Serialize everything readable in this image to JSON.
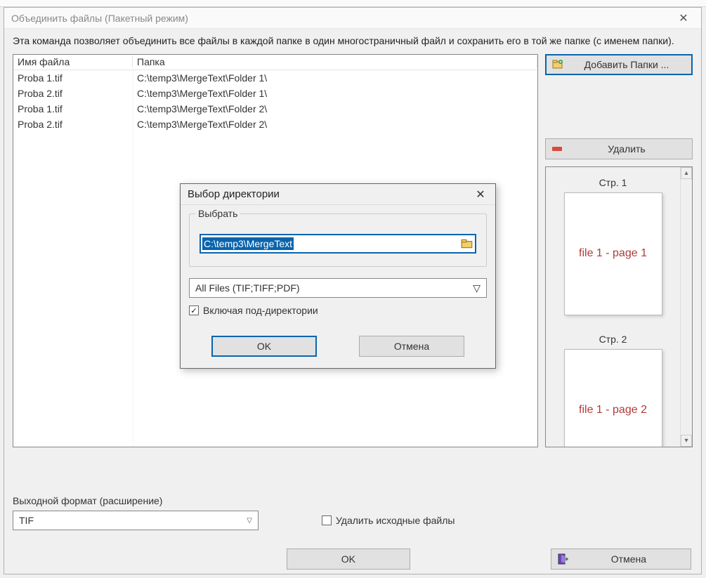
{
  "window": {
    "title": "Объединить файлы (Пакетный режим)",
    "description": "Эта команда позволяет объединить все файлы в каждой папке в один многостраничный файл и сохранить его в той же папке (с именем папки)."
  },
  "table": {
    "columns": {
      "name": "Имя файла",
      "folder": "Папка"
    },
    "rows": [
      {
        "name": "Proba 1.tif",
        "folder": "C:\\temp3\\MergeText\\Folder 1\\"
      },
      {
        "name": "Proba 2.tif",
        "folder": "C:\\temp3\\MergeText\\Folder 1\\"
      },
      {
        "name": "Proba 1.tif",
        "folder": "C:\\temp3\\MergeText\\Folder 2\\"
      },
      {
        "name": "Proba 2.tif",
        "folder": "C:\\temp3\\MergeText\\Folder 2\\"
      }
    ]
  },
  "buttons": {
    "add_folders": "Добавить Папки ...",
    "remove": "Удалить",
    "ok": "OK",
    "cancel": "Отмена"
  },
  "output": {
    "label": "Выходной формат (расширение)",
    "format": "TIF",
    "delete_originals_label": "Удалить исходные файлы"
  },
  "preview": {
    "pages": [
      {
        "label": "Стр. 1",
        "content": "file 1 - page 1"
      },
      {
        "label": "Стр. 2",
        "content": "file 1 - page 2"
      }
    ]
  },
  "dialog": {
    "title": "Выбор директории",
    "group_label": "Выбрать",
    "path": "C:\\temp3\\MergeText",
    "filter": "All Files (TIF;TIFF;PDF)",
    "include_sub_label": "Включая под-директории",
    "include_sub_checked": true,
    "ok": "OK",
    "cancel": "Отмена"
  }
}
